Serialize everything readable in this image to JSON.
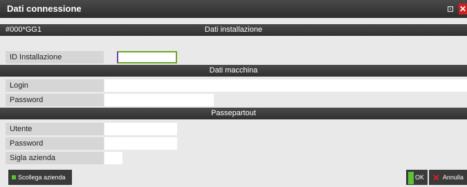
{
  "window": {
    "title": "Dati connessione",
    "maximize_glyph": "⊡",
    "close_glyph": "✕"
  },
  "installation": {
    "code": "#000*GG1",
    "section_title": "Dati installazione",
    "id_label": "ID Installazione",
    "id_value": ""
  },
  "machine": {
    "section_title": "Dati macchina",
    "login_label": "Login",
    "login_value": "",
    "password_label": "Password",
    "password_value": ""
  },
  "passepartout": {
    "section_title": "Passepartout",
    "user_label": "Utente",
    "user_value": "",
    "password_label": "Password",
    "password_value": "",
    "company_label": "Sigla azienda",
    "company_value": ""
  },
  "buttons": {
    "unlink_label": "Scollega azienda",
    "ok_label": "OK",
    "cancel_label": "Annulla"
  },
  "colors": {
    "accent_green": "#5bc236",
    "close_red": "#d02020"
  }
}
